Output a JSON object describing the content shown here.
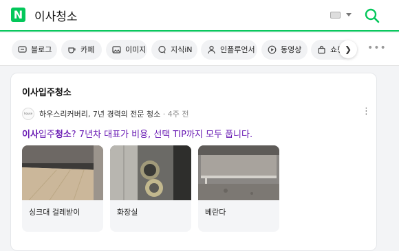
{
  "header": {
    "logo_letter": "N",
    "query": "이사청소",
    "accent_color": "#03c75a"
  },
  "tabs": [
    {
      "label": "블로그",
      "icon": "blog-icon"
    },
    {
      "label": "카페",
      "icon": "cafe-cup-icon"
    },
    {
      "label": "이미지",
      "icon": "image-icon"
    },
    {
      "label": "지식iN",
      "icon": "knowledge-bubble-icon"
    },
    {
      "label": "인플루언서",
      "icon": "person-icon"
    },
    {
      "label": "동영상",
      "icon": "play-icon"
    },
    {
      "label": "쇼핑",
      "icon": "shopping-bag-icon"
    }
  ],
  "card": {
    "title": "이사입주청소",
    "source": {
      "avatar_text": "house recovery",
      "name": "하우스리커버리, 7년 경력의 전문 청소",
      "separator": " · ",
      "time": "4주 전"
    },
    "headline": {
      "part1": "이사",
      "part2": "입주",
      "part3": "청소",
      "part4": "? 7년차 대표가 비용, 선택 TIP까지 모두 풉니다."
    },
    "thumbnails": [
      {
        "caption": "싱크대 걸레받이"
      },
      {
        "caption": "화장실"
      },
      {
        "caption": "베란다"
      }
    ]
  }
}
